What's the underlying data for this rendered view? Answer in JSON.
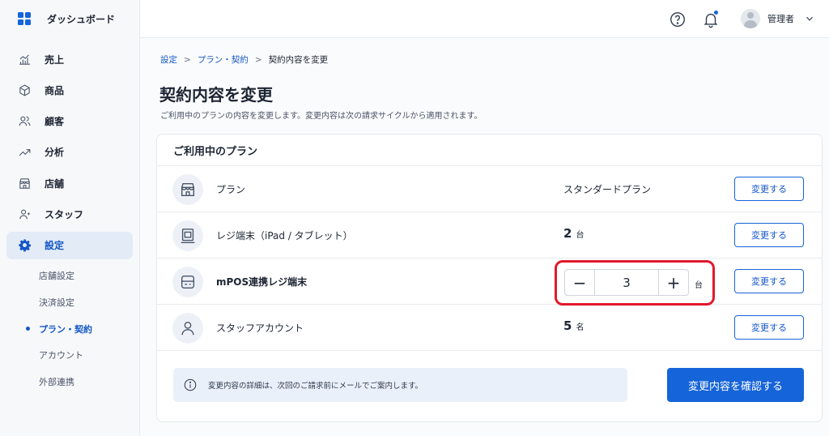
{
  "sidebar": {
    "title": "ダッシュボード",
    "nav": [
      {
        "label": "売上",
        "icon": "chart-icon"
      },
      {
        "label": "商品",
        "icon": "box-icon"
      },
      {
        "label": "顧客",
        "icon": "users-icon"
      },
      {
        "label": "分析",
        "icon": "trend-icon"
      },
      {
        "label": "店舗",
        "icon": "store-icon"
      },
      {
        "label": "スタッフ",
        "icon": "staff-icon"
      },
      {
        "label": "設定",
        "icon": "gear-icon",
        "active": true
      }
    ],
    "sub_nav": [
      {
        "label": "店舗設定"
      },
      {
        "label": "決済設定"
      },
      {
        "label": "プラン・契約",
        "active": true
      },
      {
        "label": "アカウント"
      },
      {
        "label": "外部連携"
      }
    ]
  },
  "header": {
    "user_name": "管理者",
    "has_notification": true
  },
  "breadcrumb": [
    "設定",
    "プラン・契約",
    "契約内容を変更"
  ],
  "page": {
    "title": "契約内容を変更",
    "description": "ご利用中のプランの内容を変更します。変更内容は次の請求サイクルから適用されます。"
  },
  "card": {
    "title": "ご利用中のプラン",
    "rows": [
      {
        "label": "プラン",
        "value": "スタンダードプラン",
        "icon": "store-icon",
        "button": "変更する"
      },
      {
        "label": "レジ端末（iPad / タブレット）",
        "count": "2",
        "unit": "台",
        "icon": "tablet-icon",
        "button": "変更する"
      },
      {
        "label": "mPOS連携レジ端末",
        "count": "3",
        "unit": "台",
        "icon": "pos-terminal-icon",
        "button": "変更する",
        "stepper": true
      },
      {
        "label": "スタッフアカウント",
        "count": "5",
        "unit": "名",
        "icon": "person-icon",
        "button": "変更する"
      }
    ],
    "stepper": {
      "minus": "−",
      "plus": "+"
    },
    "notice": "変更内容の詳細は、次回のご請求前にメールでご案内します。",
    "confirm_button": "変更内容を確認する"
  },
  "colors": {
    "accent": "#1664d9",
    "highlight": "#e0192c"
  }
}
